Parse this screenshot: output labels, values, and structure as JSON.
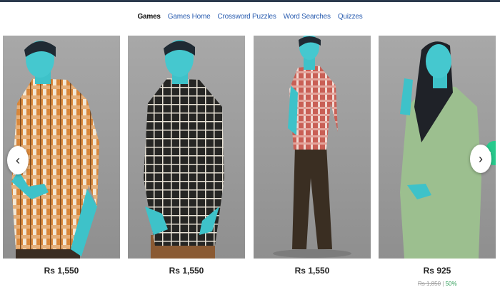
{
  "nav": {
    "items": [
      {
        "label": "Games",
        "active": true
      },
      {
        "label": "Games Home",
        "active": false
      },
      {
        "label": "Crossword Puzzles",
        "active": false
      },
      {
        "label": "Word Searches",
        "active": false
      },
      {
        "label": "Quizzes",
        "active": false
      }
    ]
  },
  "carousel": {
    "prev_icon": "chevron-left-icon",
    "next_icon": "chevron-right-icon",
    "products": [
      {
        "price": "Rs 1,550",
        "image": "man-orange-check-shirt"
      },
      {
        "price": "Rs 1,550",
        "image": "man-black-check-shirt"
      },
      {
        "price": "Rs 1,550",
        "image": "man-red-check-shirt"
      },
      {
        "price": "Rs 925",
        "original_price": "Rs 1,850",
        "discount": "50%",
        "image": "woman-green-satin-shirt"
      }
    ]
  },
  "colors": {
    "nav_link": "#2a5db0",
    "nav_active": "#111111",
    "accent_tab": "#27c98c",
    "discount": "#2e9d57"
  }
}
